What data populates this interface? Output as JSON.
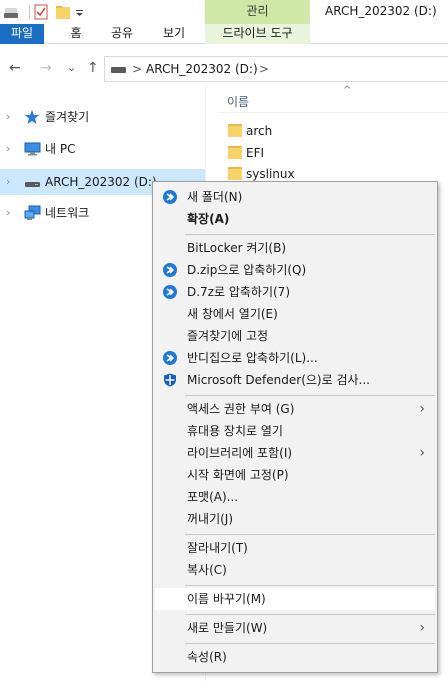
{
  "window": {
    "title": "ARCH_202302 (D:)",
    "context_tab": "관리"
  },
  "ribbon": {
    "tabs": [
      "파일",
      "홈",
      "공유",
      "보기",
      "드라이브 도구"
    ]
  },
  "address": {
    "segment": "ARCH_202302 (D:)",
    "separator": ">"
  },
  "nav": {
    "back_glyph": "←",
    "forward_glyph": "→",
    "recent_glyph": "⌄",
    "up_glyph": "↑",
    "items": [
      {
        "label": "즐겨찾기",
        "icon": "star-icon"
      },
      {
        "label": "내 PC",
        "icon": "pc-icon"
      },
      {
        "label": "ARCH_202302 (D:)",
        "icon": "drive-icon",
        "selected": true
      },
      {
        "label": "네트워크",
        "icon": "network-icon"
      }
    ],
    "expander_glyph": "›"
  },
  "list": {
    "column_name": "이름",
    "sort_glyph": "^",
    "files": [
      "arch",
      "EFI",
      "syslinux"
    ]
  },
  "menu": {
    "submenu_glyph": "›",
    "items": [
      {
        "label": "새 폴더(N)",
        "icon": "bandizip-icon"
      },
      {
        "label": "확장(A)",
        "bold": true
      },
      {
        "label": "BitLocker 켜기(B)"
      },
      {
        "label": "D.zip으로 압축하기(Q)",
        "icon": "bandizip-icon"
      },
      {
        "label": "D.7z로 압축하기(7)",
        "icon": "bandizip-icon"
      },
      {
        "label": "새 창에서 열기(E)"
      },
      {
        "label": "즐겨찾기에 고정"
      },
      {
        "label": "반디집으로 압축하기(L)...",
        "icon": "bandizip-icon"
      },
      {
        "label": "Microsoft Defender(으)로 검사...",
        "icon": "defender-shield-icon"
      },
      {
        "label": "액세스 권한 부여 (G)",
        "submenu": true
      },
      {
        "label": "휴대용 장치로 열기"
      },
      {
        "label": "라이브러리에 포함(I)",
        "submenu": true
      },
      {
        "label": "시작 화면에 고정(P)"
      },
      {
        "label": "포맷(A)..."
      },
      {
        "label": "꺼내기(J)"
      },
      {
        "label": "잘라내기(T)"
      },
      {
        "label": "복사(C)"
      },
      {
        "label": "이름 바꾸기(M)",
        "highlighted": true
      },
      {
        "label": "새로 만들기(W)",
        "submenu": true
      },
      {
        "label": "속성(R)"
      }
    ]
  },
  "colors": {
    "accent": "#1a6fc4",
    "manage": "#cfe8a8",
    "selection": "#cce8ff",
    "bandizip": "#1e78d8"
  }
}
